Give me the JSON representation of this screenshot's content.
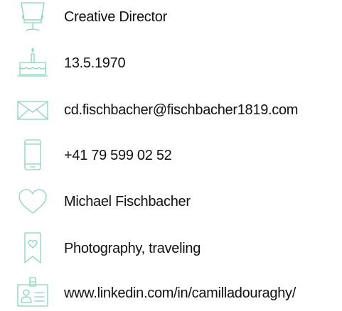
{
  "theme": {
    "icon_color": "#86d4bd",
    "text_color": "#111111"
  },
  "profile": {
    "items": [
      {
        "icon": "chair-icon",
        "text": "Creative Director"
      },
      {
        "icon": "birthday-cake-icon",
        "text": "13.5.1970"
      },
      {
        "icon": "envelope-icon",
        "text": "cd.fischbacher@fischbacher1819.com"
      },
      {
        "icon": "smartphone-icon",
        "text": "+41 79 599 02 52"
      },
      {
        "icon": "heart-icon",
        "text": "Michael Fischbacher"
      },
      {
        "icon": "bookmark-heart-icon",
        "text": "Photography, traveling"
      },
      {
        "icon": "id-badge-icon",
        "text": "www.linkedin.com/in/camilladouraghy/"
      }
    ]
  }
}
